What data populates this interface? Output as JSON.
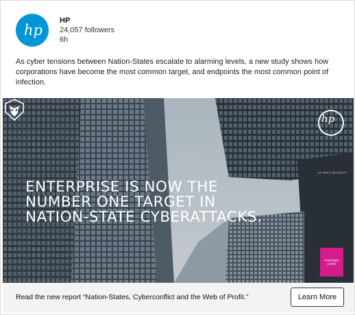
{
  "post": {
    "company_name": "HP",
    "followers": "24,057 followers",
    "age": "6h",
    "body": "As cyber tensions between Nation-States escalate to alarming levels, a new study shows how corporations have become the most common target, and endpoints the most common point of infection.",
    "logo_text": "hp"
  },
  "creative": {
    "headline": "ENTERPRISE IS NOW THE\nNUMBER ONE TARGET IN\nNATION-STATE CYBERATTACKS.",
    "brand_mark": "hp",
    "security_caption": "HP WOLF SECURITY",
    "partner_logo_line1": "PARTNER",
    "partner_logo_line2": "LOGO"
  },
  "footer": {
    "description": "Read the new report “Nation-States, Cyberconflict and the Web of Profit.”",
    "cta": "Learn More"
  },
  "colors": {
    "hp_blue": "#0096d6",
    "partner_pink": "#d41c8c"
  }
}
